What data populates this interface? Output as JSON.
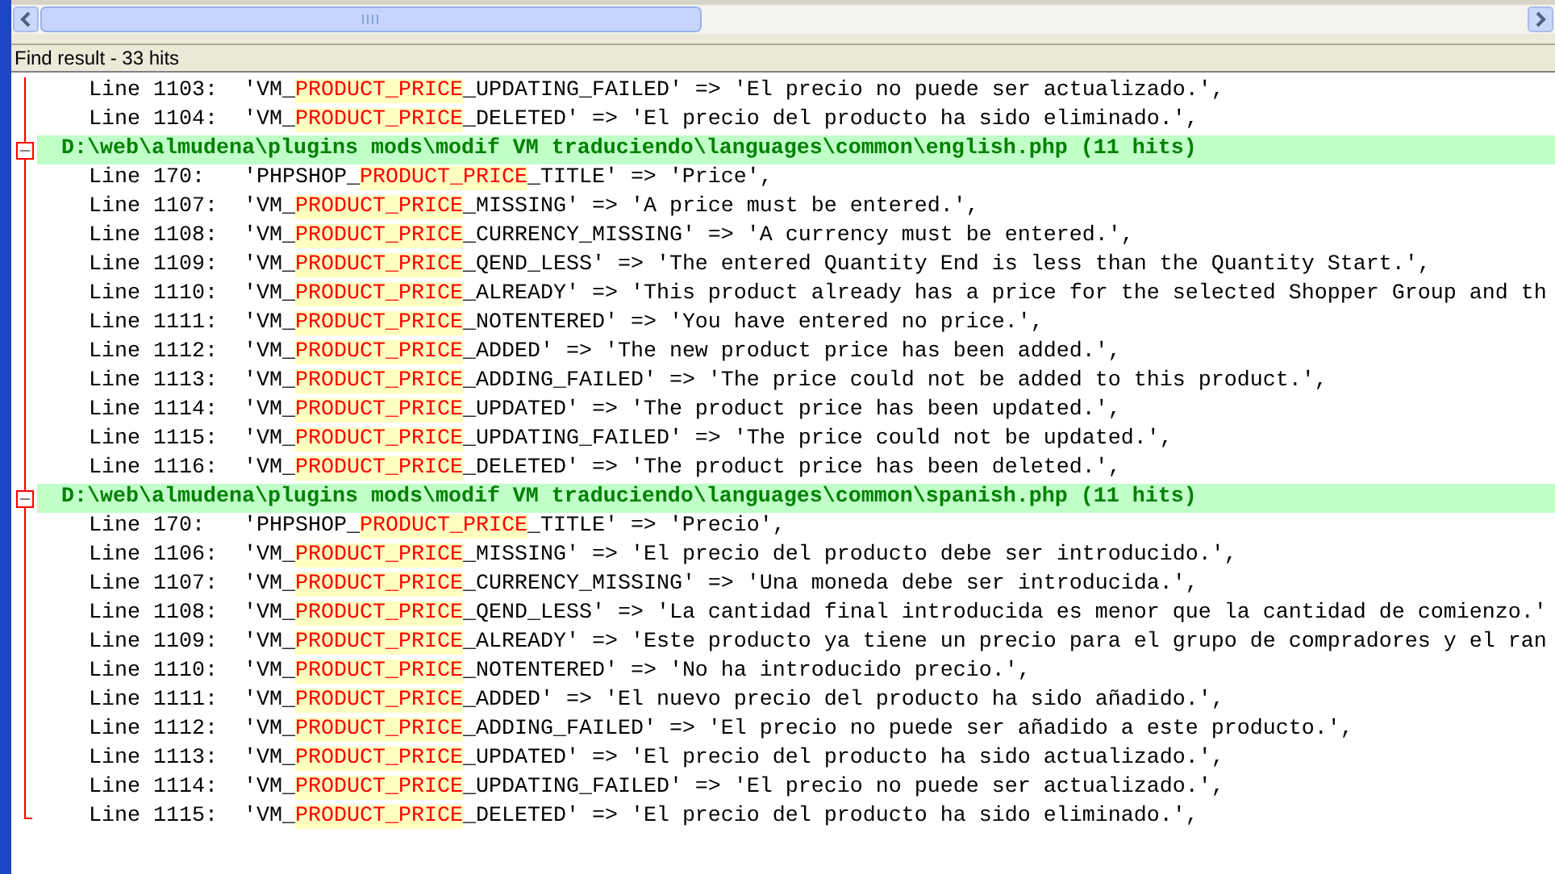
{
  "panel": {
    "title": "Find result - 33 hits"
  },
  "rows": [
    {
      "kind": "line",
      "before": "Line 1103:  'VM_",
      "match": "PRODUCT_PRICE",
      "after": "_UPDATING_FAILED' => 'El precio no puede ser actualizado.',"
    },
    {
      "kind": "line",
      "before": "Line 1104:  'VM_",
      "match": "PRODUCT_PRICE",
      "after": "_DELETED' => 'El precio del producto ha sido eliminado.',"
    },
    {
      "kind": "file",
      "text": "D:\\web\\almudena\\plugins mods\\modif VM traduciendo\\languages\\common\\english.php (11 hits)",
      "expanded": true
    },
    {
      "kind": "line",
      "before": "Line 170:   'PHPSHOP_",
      "match": "PRODUCT_PRICE",
      "after": "_TITLE' => 'Price',"
    },
    {
      "kind": "line",
      "before": "Line 1107:  'VM_",
      "match": "PRODUCT_PRICE",
      "after": "_MISSING' => 'A price must be entered.',"
    },
    {
      "kind": "line",
      "before": "Line 1108:  'VM_",
      "match": "PRODUCT_PRICE",
      "after": "_CURRENCY_MISSING' => 'A currency must be entered.',"
    },
    {
      "kind": "line",
      "before": "Line 1109:  'VM_",
      "match": "PRODUCT_PRICE",
      "after": "_QEND_LESS' => 'The entered Quantity End is less than the Quantity Start.',"
    },
    {
      "kind": "line",
      "before": "Line 1110:  'VM_",
      "match": "PRODUCT_PRICE",
      "after": "_ALREADY' => 'This product already has a price for the selected Shopper Group and th"
    },
    {
      "kind": "line",
      "before": "Line 1111:  'VM_",
      "match": "PRODUCT_PRICE",
      "after": "_NOTENTERED' => 'You have entered no price.',"
    },
    {
      "kind": "line",
      "before": "Line 1112:  'VM_",
      "match": "PRODUCT_PRICE",
      "after": "_ADDED' => 'The new product price has been added.',"
    },
    {
      "kind": "line",
      "before": "Line 1113:  'VM_",
      "match": "PRODUCT_PRICE",
      "after": "_ADDING_FAILED' => 'The price could not be added to this product.',"
    },
    {
      "kind": "line",
      "before": "Line 1114:  'VM_",
      "match": "PRODUCT_PRICE",
      "after": "_UPDATED' => 'The product price has been updated.',"
    },
    {
      "kind": "line",
      "before": "Line 1115:  'VM_",
      "match": "PRODUCT_PRICE",
      "after": "_UPDATING_FAILED' => 'The price could not be updated.',"
    },
    {
      "kind": "line",
      "before": "Line 1116:  'VM_",
      "match": "PRODUCT_PRICE",
      "after": "_DELETED' => 'The product price has been deleted.',"
    },
    {
      "kind": "file",
      "text": "D:\\web\\almudena\\plugins mods\\modif VM traduciendo\\languages\\common\\spanish.php (11 hits)",
      "expanded": true
    },
    {
      "kind": "line",
      "before": "Line 170:   'PHPSHOP_",
      "match": "PRODUCT_PRICE",
      "after": "_TITLE' => 'Precio',"
    },
    {
      "kind": "line",
      "before": "Line 1106:  'VM_",
      "match": "PRODUCT_PRICE",
      "after": "_MISSING' => 'El precio del producto debe ser introducido.',"
    },
    {
      "kind": "line",
      "before": "Line 1107:  'VM_",
      "match": "PRODUCT_PRICE",
      "after": "_CURRENCY_MISSING' => 'Una moneda debe ser introducida.',"
    },
    {
      "kind": "line",
      "before": "Line 1108:  'VM_",
      "match": "PRODUCT_PRICE",
      "after": "_QEND_LESS' => 'La cantidad final introducida es menor que la cantidad de comienzo.'"
    },
    {
      "kind": "line",
      "before": "Line 1109:  'VM_",
      "match": "PRODUCT_PRICE",
      "after": "_ALREADY' => 'Este producto ya tiene un precio para el grupo de compradores y el ran"
    },
    {
      "kind": "line",
      "before": "Line 1110:  'VM_",
      "match": "PRODUCT_PRICE",
      "after": "_NOTENTERED' => 'No ha introducido precio.',"
    },
    {
      "kind": "line",
      "before": "Line 1111:  'VM_",
      "match": "PRODUCT_PRICE",
      "after": "_ADDED' => 'El nuevo precio del producto ha sido añadido.',"
    },
    {
      "kind": "line",
      "before": "Line 1112:  'VM_",
      "match": "PRODUCT_PRICE",
      "after": "_ADDING_FAILED' => 'El precio no puede ser añadido a este producto.',"
    },
    {
      "kind": "line",
      "before": "Line 1113:  'VM_",
      "match": "PRODUCT_PRICE",
      "after": "_UPDATED' => 'El precio del producto ha sido actualizado.',"
    },
    {
      "kind": "line",
      "before": "Line 1114:  'VM_",
      "match": "PRODUCT_PRICE",
      "after": "_UPDATING_FAILED' => 'El precio no puede ser actualizado.',"
    },
    {
      "kind": "line",
      "before": "Line 1115:  'VM_",
      "match": "PRODUCT_PRICE",
      "after": "_DELETED' => 'El precio del producto ha sido eliminado.',"
    }
  ]
}
